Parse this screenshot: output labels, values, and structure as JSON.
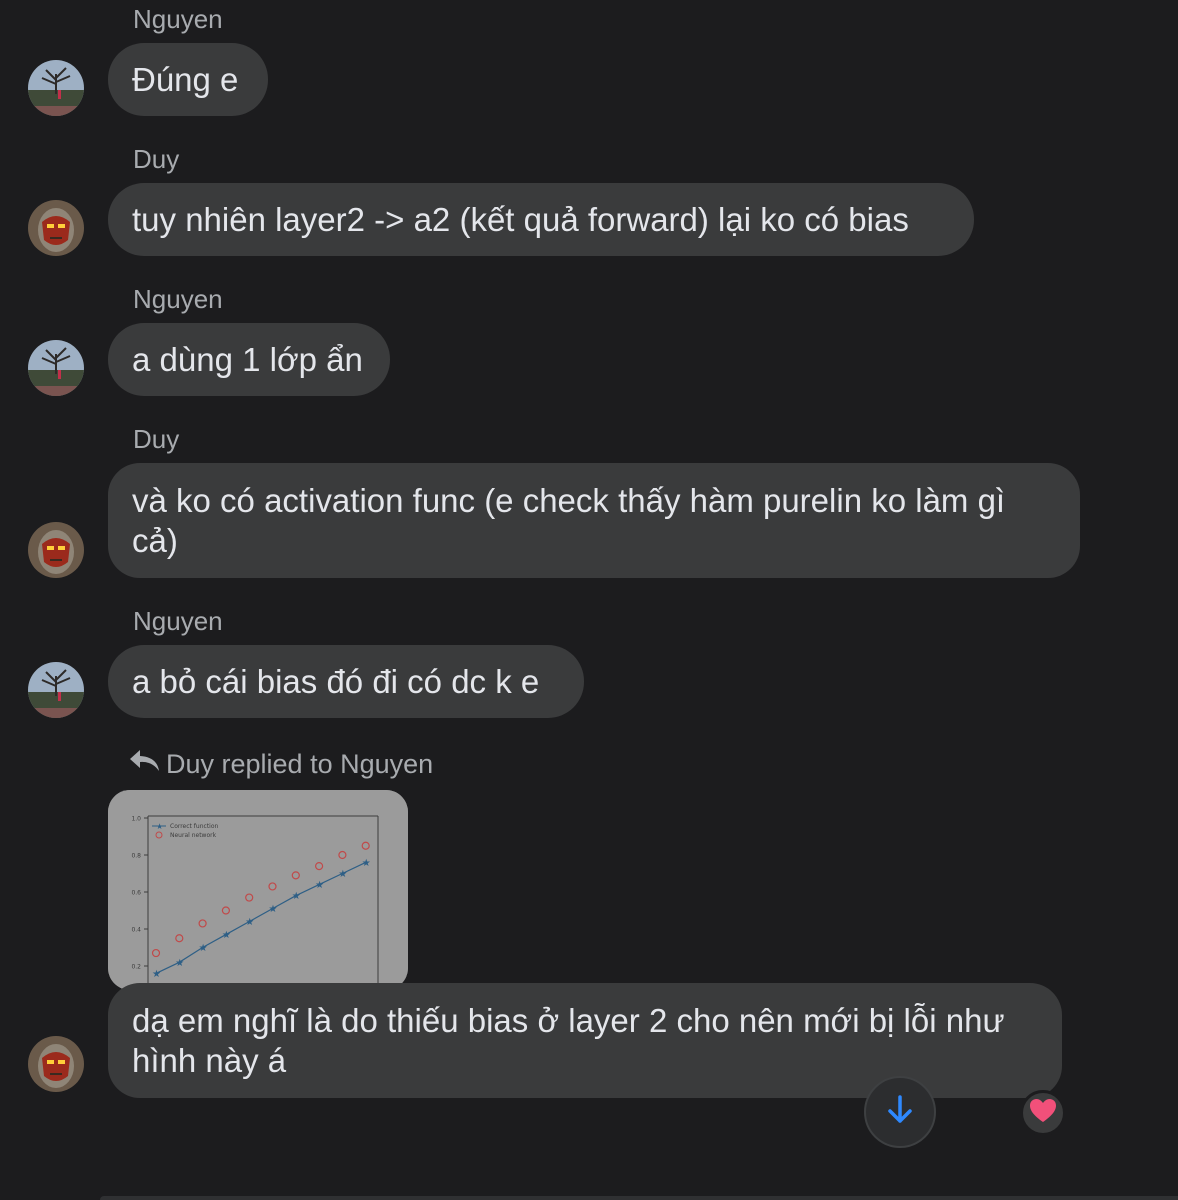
{
  "conversation": {
    "messages": [
      {
        "sender": "Nguyen",
        "text": "Đúng e"
      },
      {
        "sender": "Duy",
        "text": "tuy nhiên layer2 -> a2 (kết quả forward) lại ko có bias"
      },
      {
        "sender": "Nguyen",
        "text": "a dùng 1 lớp ẩn"
      },
      {
        "sender": "Duy",
        "text": "và ko có activation func (e check thấy hàm purelin ko làm gì cả)"
      },
      {
        "sender": "Nguyen",
        "text": "a bỏ cái bias đó đi có dc k e"
      },
      {
        "text": "dạ em nghĩ là do thiếu bias ở layer 2 cho nên mới bị lỗi như hình này á"
      }
    ],
    "reply_label": "Duy replied to Nguyen",
    "reaction_icon": "heart-icon",
    "scroll_icon": "arrow-down-icon"
  },
  "chart_data": {
    "type": "scatter",
    "legend": [
      "Correct function",
      "Neural network"
    ],
    "legend_placement": "top-left",
    "yticks": [
      "1.0",
      "0.8",
      "0.6",
      "0.4",
      "0.2"
    ],
    "ylim": [
      0,
      1.0
    ],
    "series": [
      {
        "name": "Correct function",
        "x": [
          1,
          2,
          3,
          4,
          5,
          6,
          7,
          8,
          9,
          10
        ],
        "values": [
          0.16,
          0.22,
          0.3,
          0.37,
          0.44,
          0.51,
          0.58,
          0.64,
          0.7,
          0.76
        ]
      },
      {
        "name": "Neural network",
        "x": [
          1,
          2,
          3,
          4,
          5,
          6,
          7,
          8,
          9,
          10
        ],
        "values": [
          0.27,
          0.35,
          0.43,
          0.5,
          0.57,
          0.63,
          0.69,
          0.74,
          0.8,
          0.85
        ]
      }
    ]
  },
  "colors": {
    "background": "#1c1c1e",
    "bubble": "#3a3b3c",
    "accent_blue": "#2e89ff",
    "heart": "#f2507a"
  }
}
